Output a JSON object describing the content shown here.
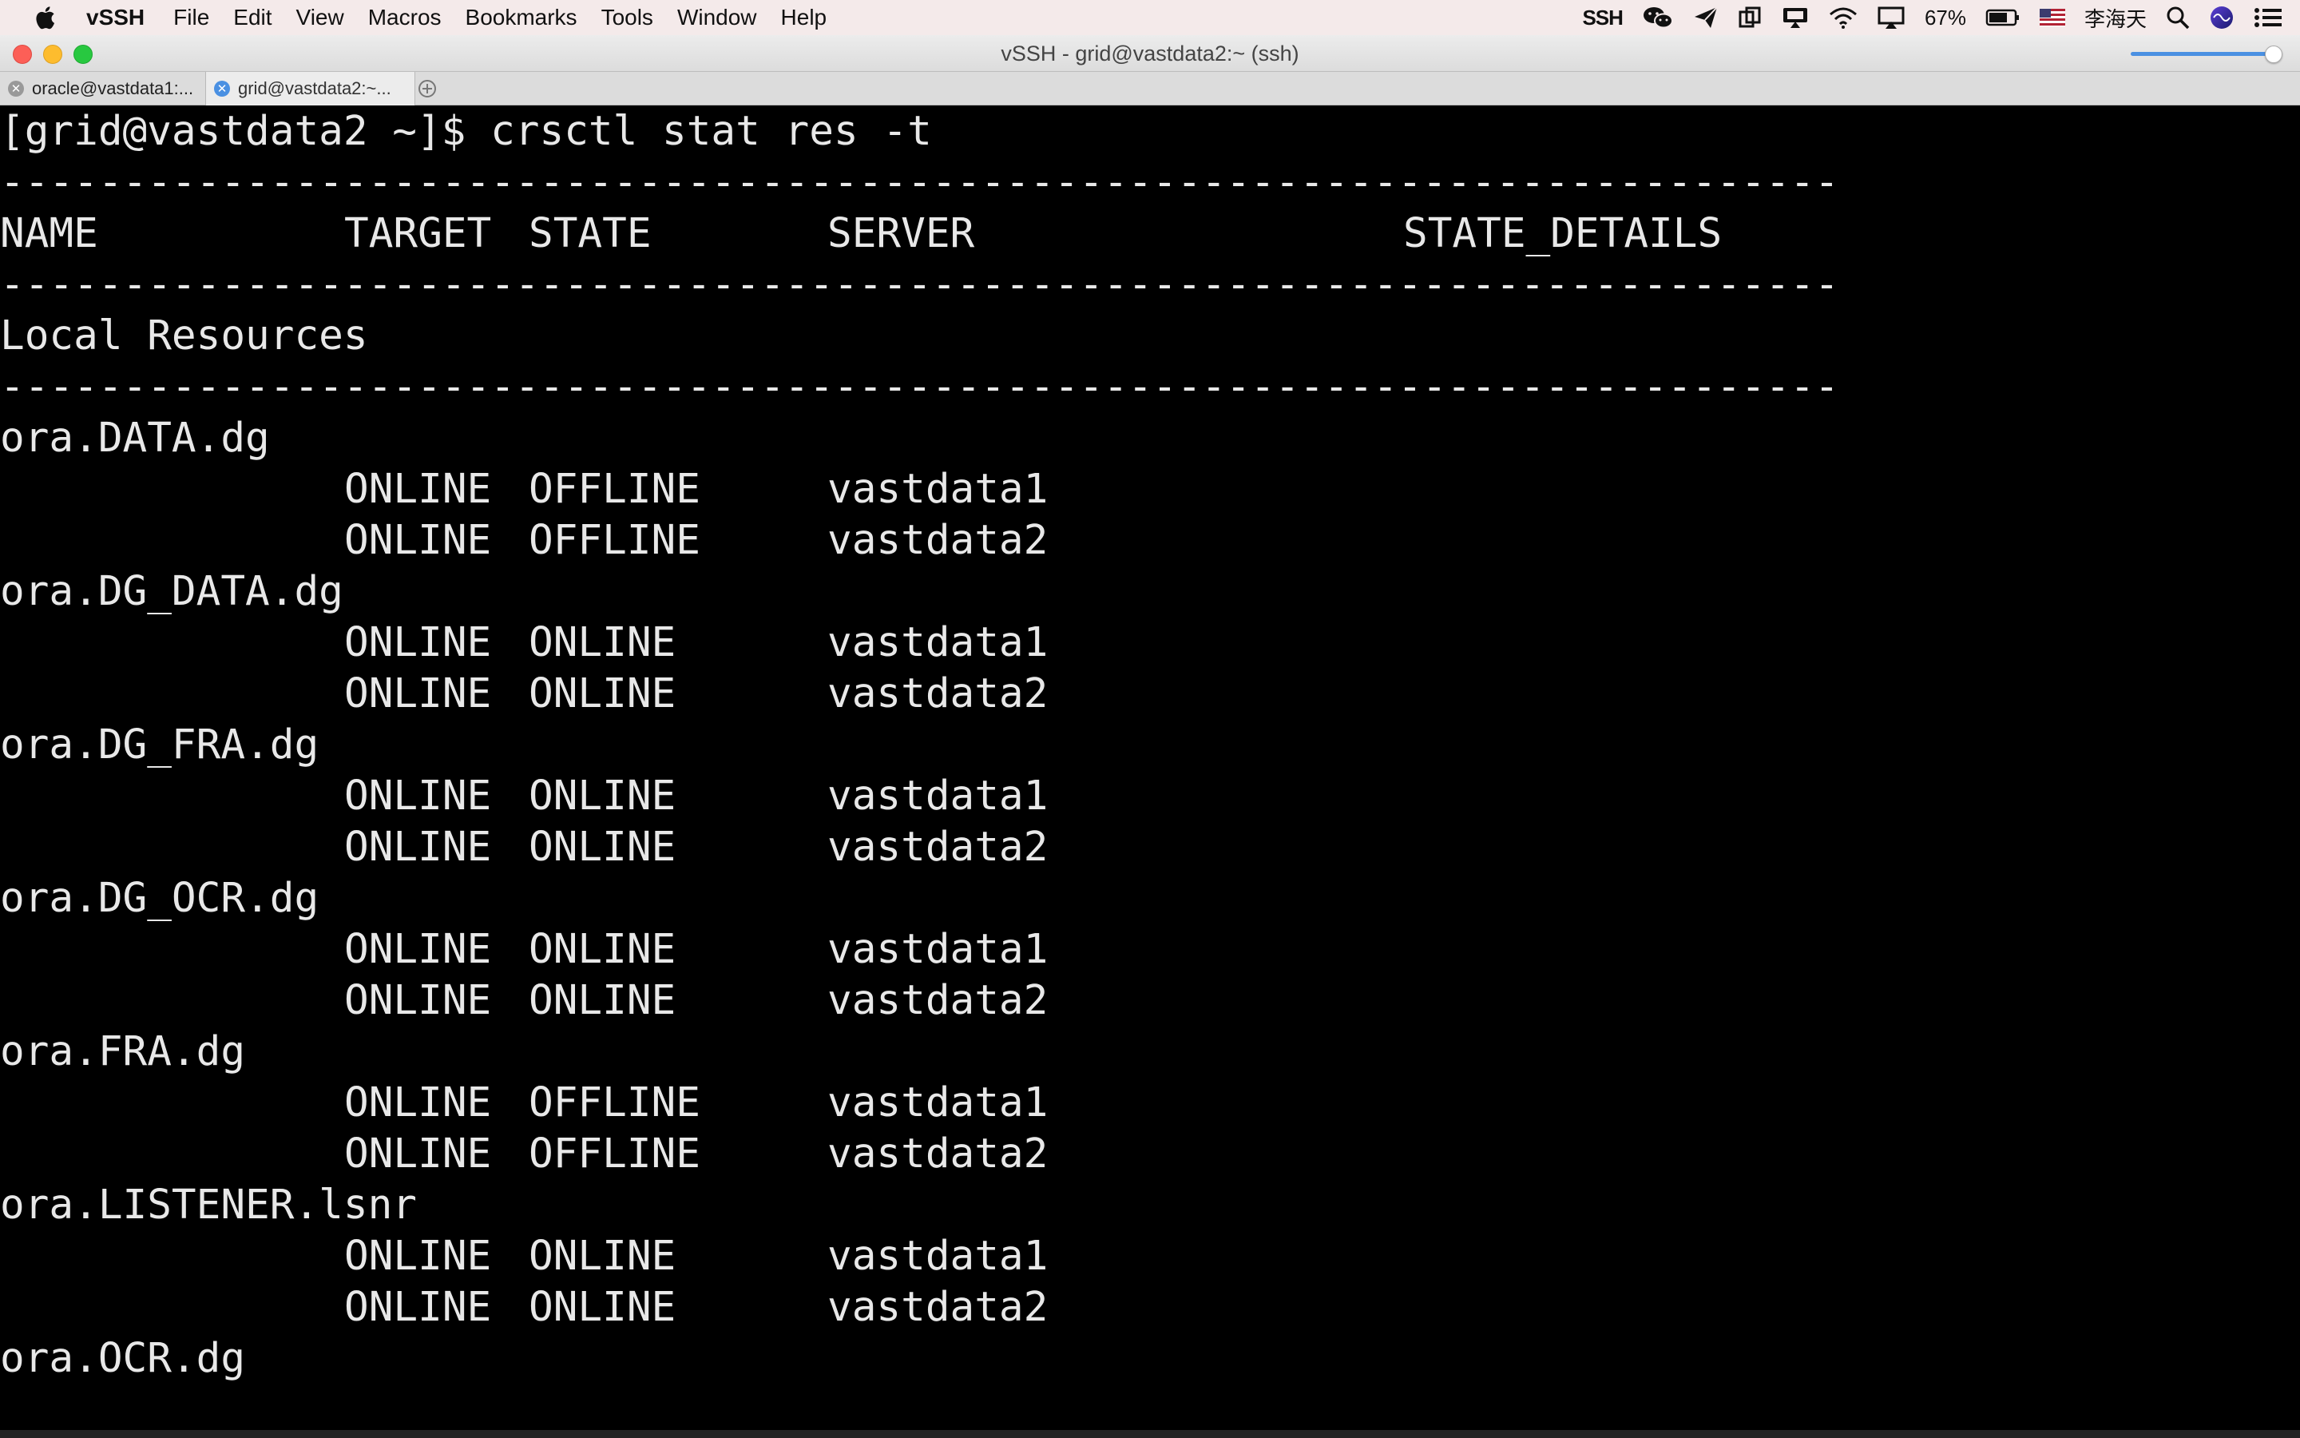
{
  "menubar": {
    "app_name": "vSSH",
    "items": [
      "File",
      "Edit",
      "View",
      "Macros",
      "Bookmarks",
      "Tools",
      "Window",
      "Help"
    ],
    "status": {
      "ssh_label": "SSH",
      "battery_percent": "67%",
      "user_name": "李海天",
      "icons": [
        "ssh-icon",
        "wechat-icon",
        "send-icon",
        "copy-icon",
        "cast-icon",
        "wifi-icon",
        "airplay-icon",
        "battery-icon",
        "flag-us-icon",
        "spotlight-icon",
        "siri-icon",
        "notification-center-icon"
      ]
    }
  },
  "window": {
    "title": "vSSH - grid@vastdata2:~ (ssh)"
  },
  "tabs": [
    {
      "label": "oracle@vastdata1:...",
      "active": false
    },
    {
      "label": "grid@vastdata2:~...",
      "active": true
    }
  ],
  "terminal": {
    "prompt": "[grid@vastdata2 ~]$ crsctl stat res -t",
    "separator": "--------------------------------------------------------------------------------",
    "headers": {
      "name": "NAME",
      "target": "TARGET",
      "state": "STATE",
      "server": "SERVER",
      "state_details": "STATE_DETAILS"
    },
    "section": "Local Resources",
    "resources": [
      {
        "name": "ora.DATA.dg",
        "rows": [
          {
            "target": "ONLINE",
            "state": "OFFLINE",
            "server": "vastdata1"
          },
          {
            "target": "ONLINE",
            "state": "OFFLINE",
            "server": "vastdata2"
          }
        ]
      },
      {
        "name": "ora.DG_DATA.dg",
        "rows": [
          {
            "target": "ONLINE",
            "state": "ONLINE",
            "server": "vastdata1"
          },
          {
            "target": "ONLINE",
            "state": "ONLINE",
            "server": "vastdata2"
          }
        ]
      },
      {
        "name": "ora.DG_FRA.dg",
        "rows": [
          {
            "target": "ONLINE",
            "state": "ONLINE",
            "server": "vastdata1"
          },
          {
            "target": "ONLINE",
            "state": "ONLINE",
            "server": "vastdata2"
          }
        ]
      },
      {
        "name": "ora.DG_OCR.dg",
        "rows": [
          {
            "target": "ONLINE",
            "state": "ONLINE",
            "server": "vastdata1"
          },
          {
            "target": "ONLINE",
            "state": "ONLINE",
            "server": "vastdata2"
          }
        ]
      },
      {
        "name": "ora.FRA.dg",
        "rows": [
          {
            "target": "ONLINE",
            "state": "OFFLINE",
            "server": "vastdata1"
          },
          {
            "target": "ONLINE",
            "state": "OFFLINE",
            "server": "vastdata2"
          }
        ]
      },
      {
        "name": "ora.LISTENER.lsnr",
        "rows": [
          {
            "target": "ONLINE",
            "state": "ONLINE",
            "server": "vastdata1"
          },
          {
            "target": "ONLINE",
            "state": "ONLINE",
            "server": "vastdata2"
          }
        ]
      },
      {
        "name": "ora.OCR.dg",
        "rows": []
      }
    ]
  }
}
